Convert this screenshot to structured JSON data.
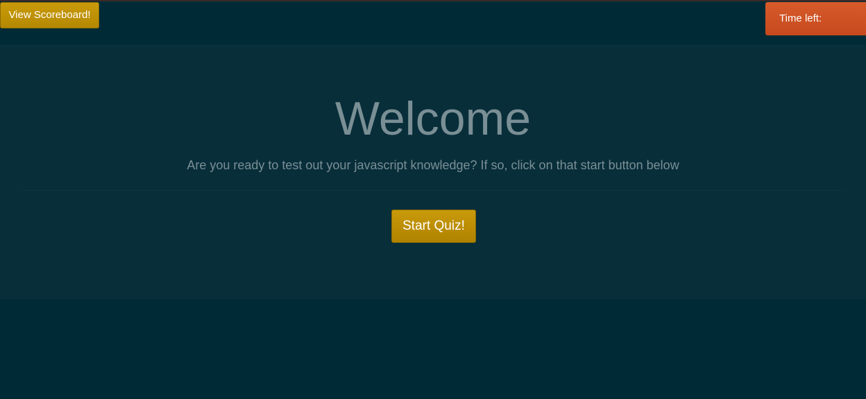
{
  "header": {
    "scoreboard_label": "View Scoreboard!",
    "timer_label": "Time left:"
  },
  "main": {
    "title": "Welcome",
    "subtitle": "Are you ready to test out your javascript knowledge? If so, click on that start button below",
    "start_label": "Start Quiz!"
  },
  "colors": {
    "background": "#002b36",
    "panel": "#082e3a",
    "accent_gold": "#b58900",
    "timer_orange": "#cb4b16",
    "text_muted": "#7a8f95"
  }
}
